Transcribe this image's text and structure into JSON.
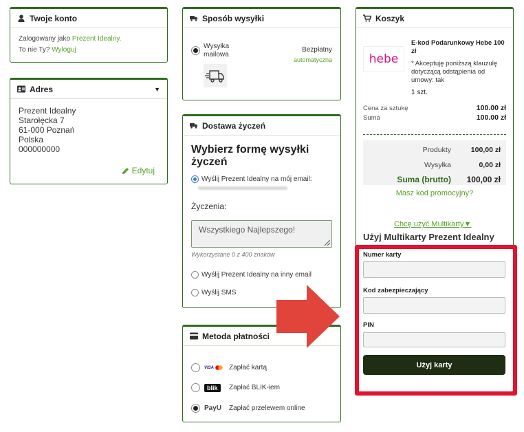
{
  "account": {
    "title": "Twoje konto",
    "logged_prefix": "Zalogowany jako",
    "logged_user": "Prezent Idealny.",
    "not_you": "To nie Ty?",
    "logout": "Wyloguj"
  },
  "address": {
    "title": "Adres",
    "lines": [
      "Prezent Idealny",
      "Starołęcka 7",
      "61-000 Poznań",
      "Polska",
      "000000000"
    ],
    "edit": "Edytuj"
  },
  "shipping": {
    "title": "Sposób wysyłki",
    "option_label_1": "Wysyłka",
    "option_label_2": "mailowa",
    "price": "Bezpłatny",
    "price_note": "automatyczna"
  },
  "wishes": {
    "title": "Dostawa życzeń",
    "heading": "Wybierz formę wysyłki życzeń",
    "opt_my_email": "Wyślij Prezent Idealny na mój email:",
    "label_wishes": "Życzenia:",
    "textarea_value": "Wszystkiego Najlepszego!",
    "counter": "Wykorzystane 0 z 400 znaków",
    "opt_other_email": "Wyślij Prezent Idealny na inny email",
    "opt_sms": "Wyślij SMS"
  },
  "payment": {
    "title": "Metoda płatności",
    "opt_card": "Zapłać kartą",
    "card_logo": "VISA",
    "opt_blik": "Zapłać BLIK-iem",
    "blik_logo": "blik",
    "opt_transfer": "Zapłać przelewem online",
    "payu_logo": "PayU"
  },
  "cart": {
    "title": "Koszyk",
    "product_logo": "hebe",
    "product_name": "E-kod Podarunkowy Hebe 100 zł",
    "accept_note": "* Akceptuję poniższą klauzulę dotyczącą odstąpienia od umowy: tak",
    "qty": "1 szt.",
    "unit_price_label": "Cena za sztukę",
    "unit_price": "100.00 zł",
    "sum_label": "Suma",
    "sum": "100.00 zł",
    "products_label": "Produkty",
    "products_value": "100,00 zł",
    "shipping_label": "Wysyłka",
    "shipping_value": "0,00 zł",
    "total_label": "Suma (brutto)",
    "total_value": "100,00 zł",
    "promo": "Masz kod promocyjny?",
    "multicard_link": "Chcę użyć Multikarty",
    "multicard_heading": "Użyj Multikarty Prezent Idealny",
    "card_number_label": "Numer karty",
    "security_code_label": "Kod zabezpieczający",
    "pin_label": "PIN",
    "use_card_button": "Użyj karty"
  },
  "colors": {
    "accent": "#5aa02c",
    "border": "#2f6b1f",
    "highlight": "#e4122f",
    "arrow": "#e0443a",
    "button": "#1f2d12"
  }
}
